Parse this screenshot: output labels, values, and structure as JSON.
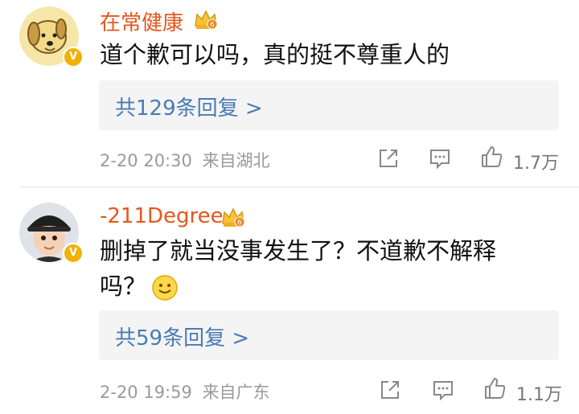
{
  "comments": [
    {
      "username": "在常健康",
      "text_lines": [
        "道个歉可以吗，真的挺不尊重人的"
      ],
      "reply_summary": "共129条回复 >",
      "timestamp": "2-20 20:30",
      "source": "来自湖北",
      "likes": "1.7万",
      "verified_badge": "V",
      "avatar_icon": "dog-avatar-icon",
      "crown_level": "6"
    },
    {
      "username": "-211Degree",
      "text_lines": [
        "删掉了就当没事发生了？不道歉不解释",
        "吗？"
      ],
      "reply_summary": "共59条回复 >",
      "timestamp": "2-20 19:59",
      "source": "来自广东",
      "likes": "1.1万",
      "verified_badge": "V",
      "avatar_icon": "child-with-cap-avatar-icon",
      "crown_level": "6",
      "emoji": "smile-emoji-icon"
    }
  ],
  "colors": {
    "username": "#e5571d",
    "reply_link": "#4a7bb5",
    "meta": "#9a9a9a",
    "reply_bg": "#f4f4f4",
    "badge": "#f2b100"
  }
}
